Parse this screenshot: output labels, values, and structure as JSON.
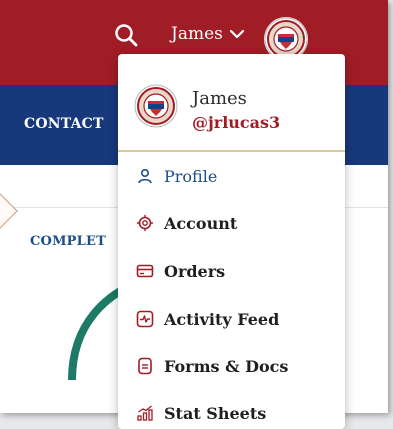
{
  "header": {
    "username": "James",
    "search_icon": "search-icon",
    "avatar_icon": "texas-vfw-seal"
  },
  "nav": {
    "contact_label": "CONTACT"
  },
  "content": {
    "section_title": "COMPLET"
  },
  "user_menu": {
    "name": "James",
    "handle": "@jrlucas3",
    "items": [
      {
        "label": "Profile",
        "icon": "user-icon"
      },
      {
        "label": "Account",
        "icon": "gear-icon"
      },
      {
        "label": "Orders",
        "icon": "credit-card-icon"
      },
      {
        "label": "Activity Feed",
        "icon": "activity-icon"
      },
      {
        "label": "Forms & Docs",
        "icon": "document-icon"
      },
      {
        "label": "Stat Sheets",
        "icon": "chart-icon"
      }
    ]
  },
  "colors": {
    "topbar": "#a11d26",
    "navbar": "#17387a",
    "accent_blue": "#1b4d87",
    "progress_green": "#1c7a66"
  }
}
